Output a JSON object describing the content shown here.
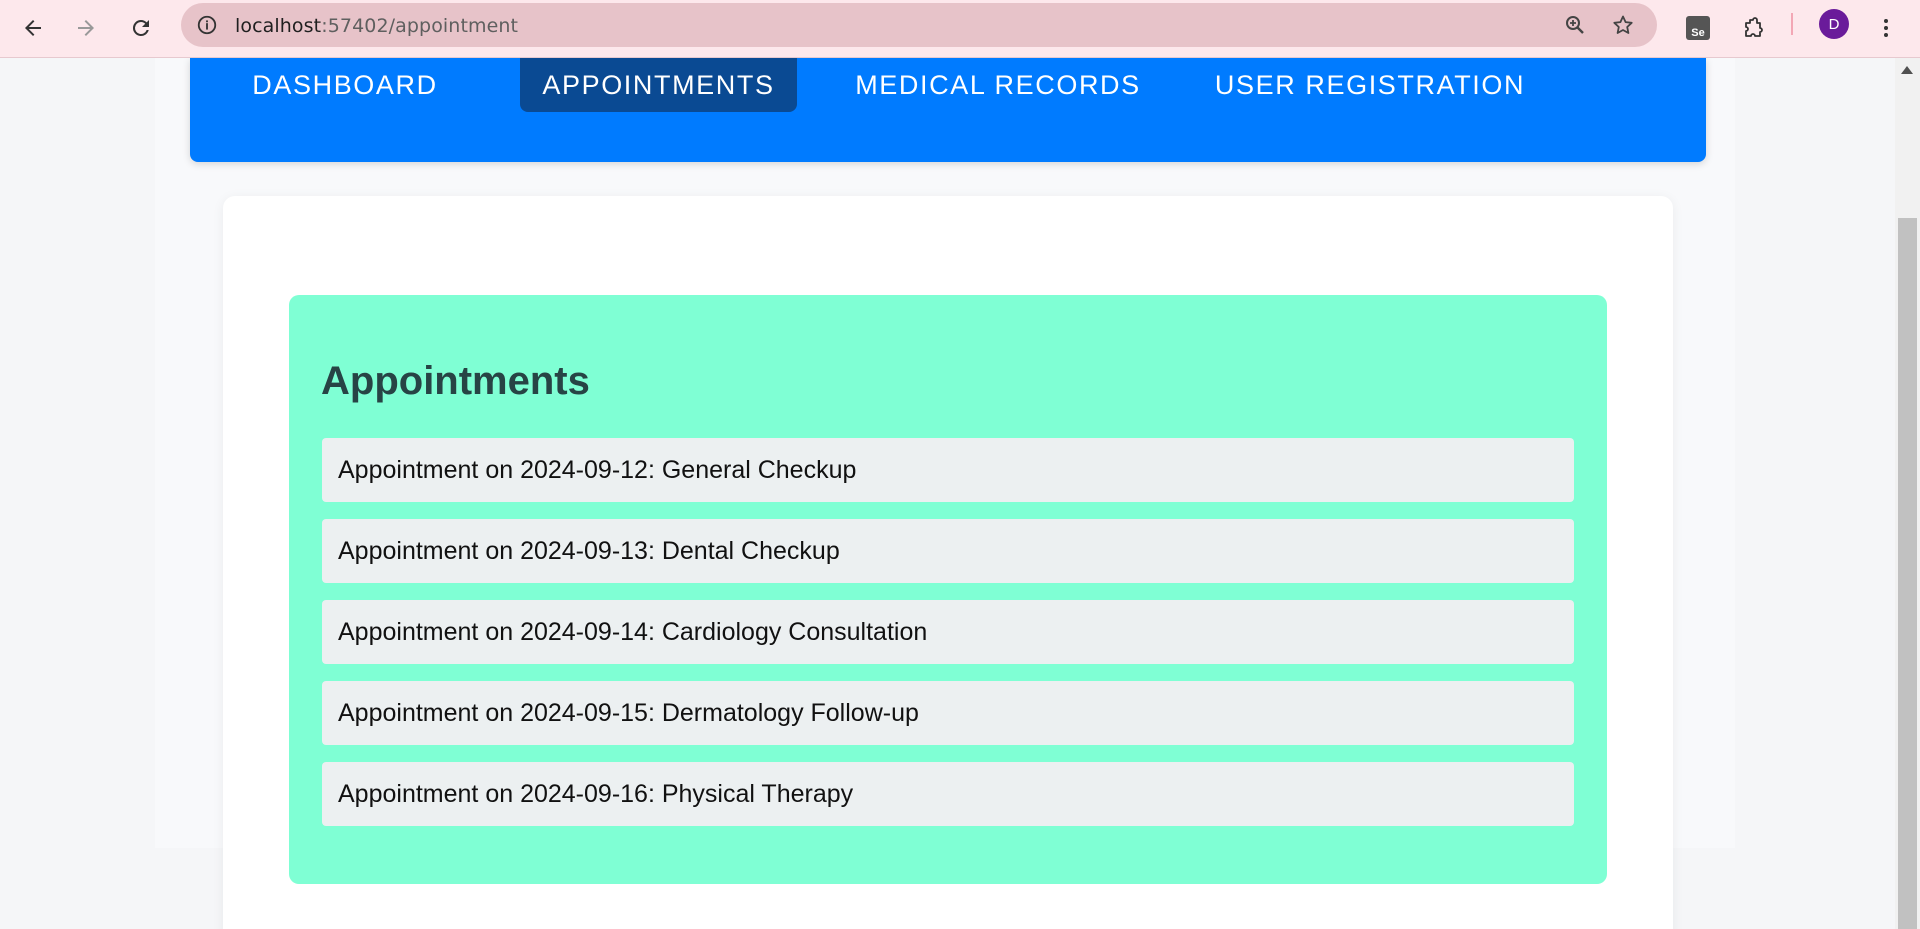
{
  "browser": {
    "url_host": "localhost",
    "url_rest": ":57402/appointment",
    "profile_initial": "D",
    "ext_label": "Se"
  },
  "nav": {
    "items": [
      {
        "label": "DASHBOARD"
      },
      {
        "label": "APPOINTMENTS"
      },
      {
        "label": "MEDICAL RECORDS"
      },
      {
        "label": "USER REGISTRATION"
      }
    ],
    "active": "APPOINTMENTS"
  },
  "appointments": {
    "title": "Appointments",
    "items": [
      "Appointment on 2024-09-12: General Checkup",
      "Appointment on 2024-09-13: Dental Checkup",
      "Appointment on 2024-09-14: Cardiology Consultation",
      "Appointment on 2024-09-15: Dermatology Follow-up",
      "Appointment on 2024-09-16: Physical Therapy"
    ]
  },
  "colors": {
    "navbar": "#007bff",
    "nav_active": "#0a4a93",
    "panel": "#7fffd4",
    "item_bg": "#ecf0f1",
    "title": "#274445"
  }
}
